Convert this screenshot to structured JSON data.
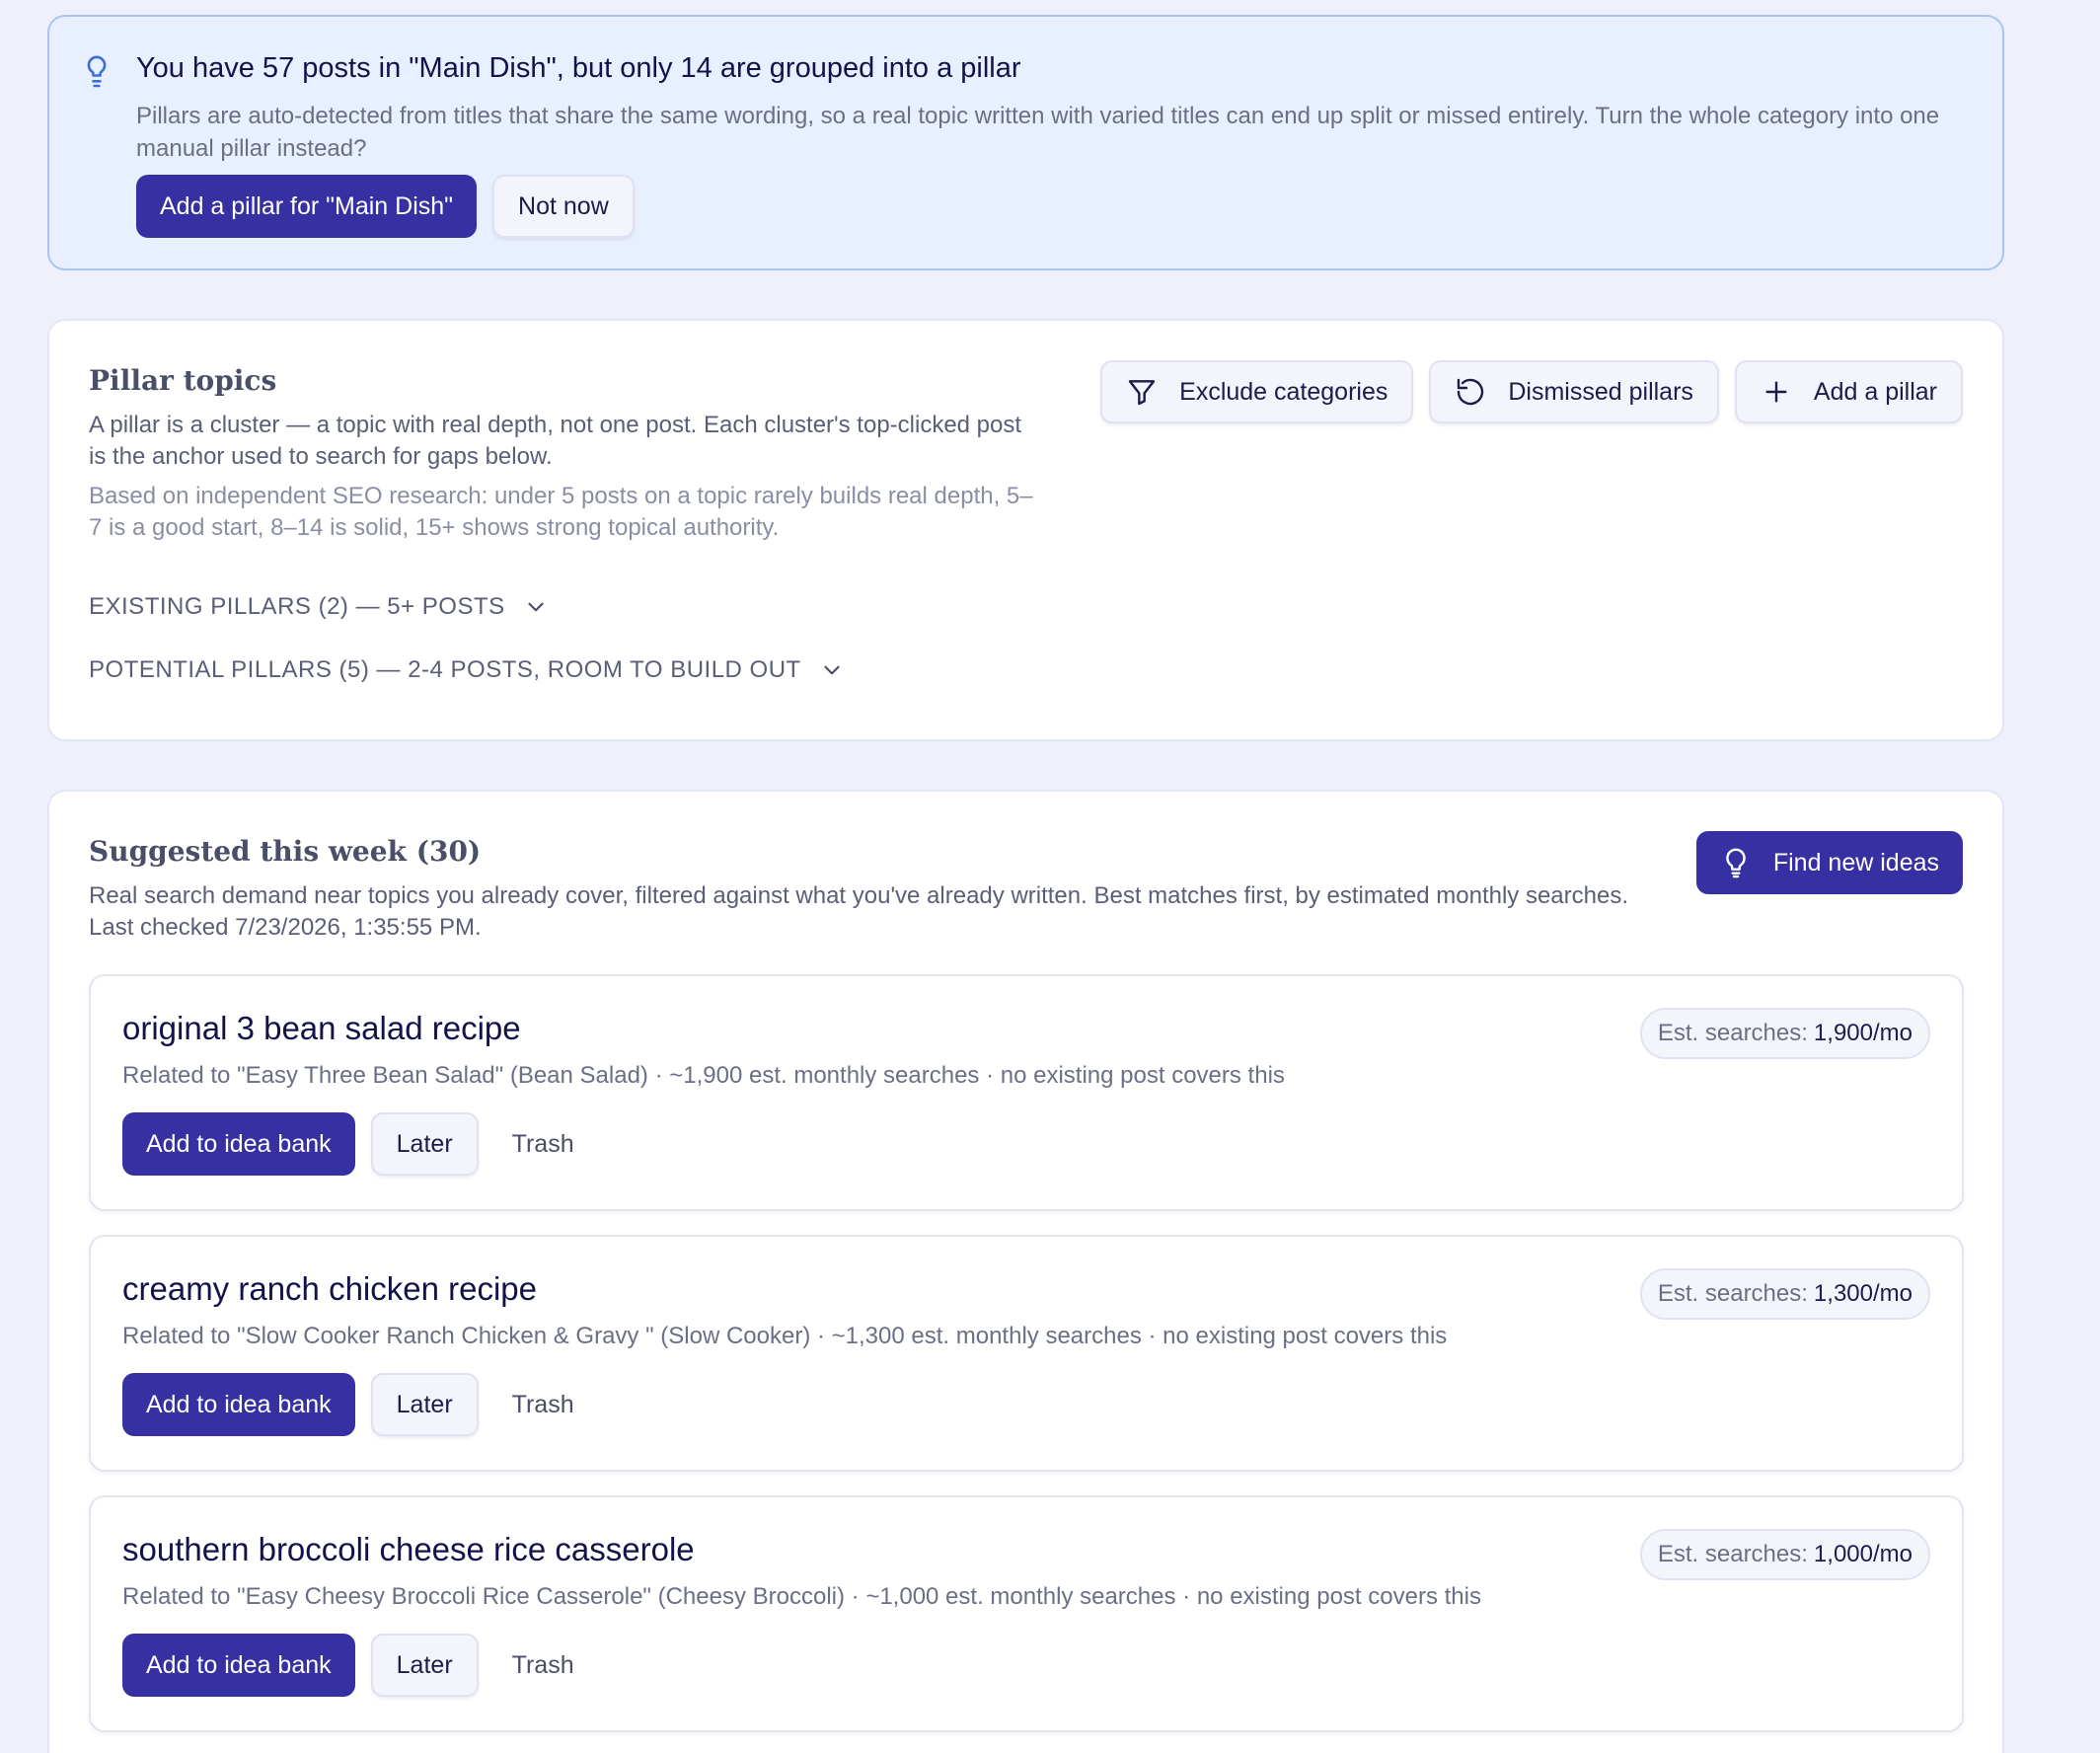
{
  "notice": {
    "title": "You have 57 posts in \"Main Dish\", but only 14 are grouped into a pillar",
    "description": "Pillars are auto-detected from titles that share the same wording, so a real topic written with varied titles can end up split or missed entirely. Turn the whole category into one manual pillar instead?",
    "primary_label": "Add a pillar for \"Main Dish\"",
    "secondary_label": "Not now",
    "icon": "lightbulb-icon"
  },
  "pillar_topics": {
    "title": "Pillar topics",
    "description": "A pillar is a cluster — a topic with real depth, not one post. Each cluster's top-clicked post is the anchor used to search for gaps below.",
    "research_note": "Based on independent SEO research: under 5 posts on a topic rarely builds real depth, 5–7 is a good start, 8–14 is solid, 15+ shows strong topical authority.",
    "toolbar": {
      "exclude_label": "Exclude categories",
      "dismissed_label": "Dismissed pillars",
      "add_label": "Add a pillar"
    },
    "existing_label": "EXISTING PILLARS (2) — 5+ POSTS",
    "potential_label": "POTENTIAL PILLARS (5) — 2-4 POSTS, ROOM TO BUILD OUT"
  },
  "suggested": {
    "title": "Suggested this week (30)",
    "description": "Real search demand near topics you already cover, filtered against what you've already written. Best matches first, by estimated monthly searches. Last checked 7/23/2026, 1:35:55 PM.",
    "find_label": "Find new ideas",
    "badge_label": "Est. searches:",
    "add_label": "Add to idea bank",
    "later_label": "Later",
    "trash_label": "Trash",
    "items": [
      {
        "title": "original 3 bean salad recipe",
        "related": "Related to \"Easy Three Bean Salad\" (Bean Salad) · ~1,900 est. monthly searches · no existing post covers this",
        "searches": "1,900/mo"
      },
      {
        "title": "creamy ranch chicken recipe",
        "related": "Related to \"Slow Cooker Ranch Chicken & Gravy \" (Slow Cooker) · ~1,300 est. monthly searches · no existing post covers this",
        "searches": "1,300/mo"
      },
      {
        "title": "southern broccoli cheese rice casserole",
        "related": "Related to \"Easy Cheesy Broccoli Rice Casserole\" (Cheesy Broccoli) · ~1,000 est. monthly searches · no existing post covers this",
        "searches": "1,000/mo"
      }
    ]
  },
  "colors": {
    "background": "#eef0fb",
    "primary": "#3730a3",
    "notice_bg": "#e8efff",
    "notice_border": "#a9c4f0",
    "icon_blue": "#3b6fd8"
  }
}
